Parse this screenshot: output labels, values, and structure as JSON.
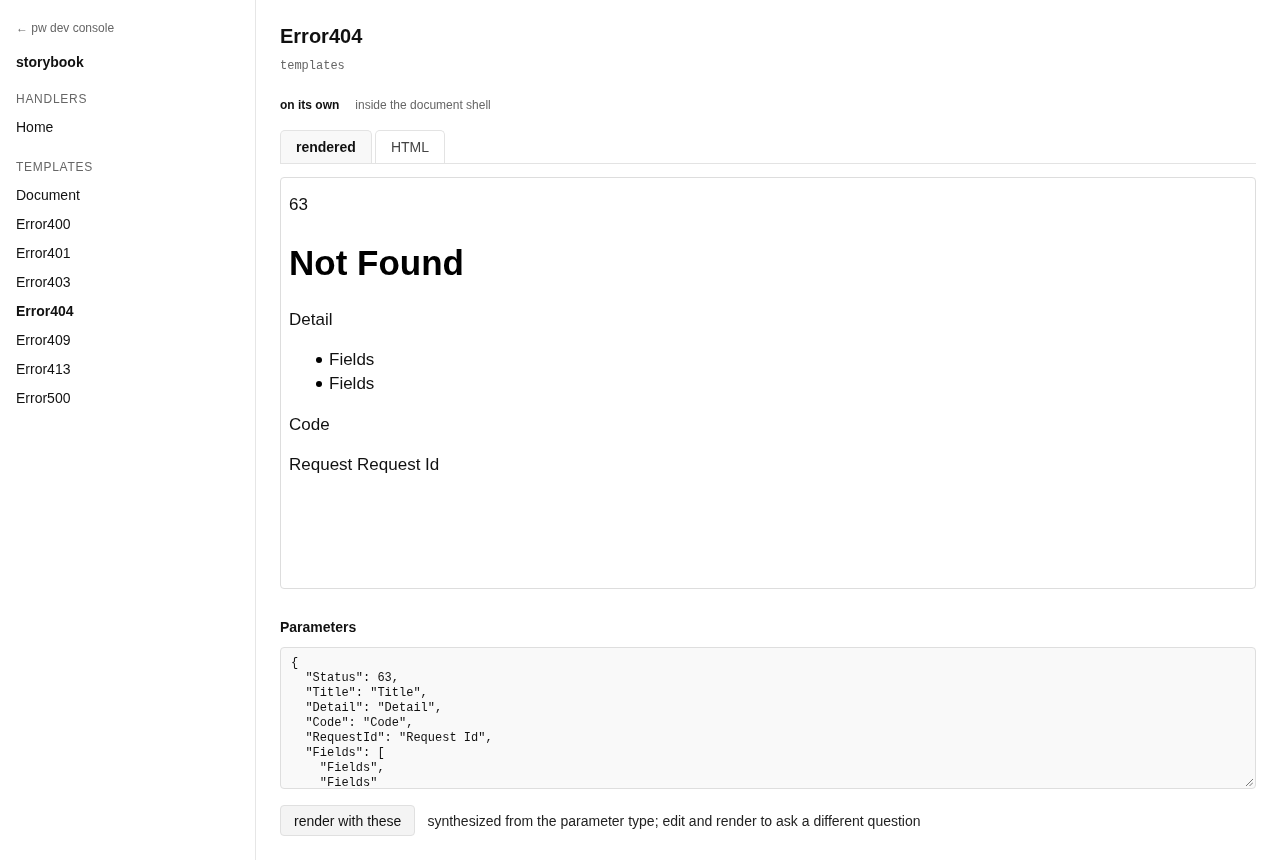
{
  "sidebar": {
    "back_link": "← pw dev console",
    "title": "storybook",
    "sections": [
      {
        "heading": "HANDLERS",
        "items": [
          {
            "label": "Home",
            "selected": false
          }
        ]
      },
      {
        "heading": "TEMPLATES",
        "items": [
          {
            "label": "Document",
            "selected": false
          },
          {
            "label": "Error400",
            "selected": false
          },
          {
            "label": "Error401",
            "selected": false
          },
          {
            "label": "Error403",
            "selected": false
          },
          {
            "label": "Error404",
            "selected": true
          },
          {
            "label": "Error409",
            "selected": false
          },
          {
            "label": "Error413",
            "selected": false
          },
          {
            "label": "Error500",
            "selected": false
          }
        ]
      }
    ]
  },
  "header": {
    "title": "Error404",
    "subtitle": "templates"
  },
  "modes": [
    {
      "label": "on its own",
      "selected": true
    },
    {
      "label": "inside the document shell",
      "selected": false
    }
  ],
  "tabs": [
    {
      "label": "rendered",
      "selected": true
    },
    {
      "label": "HTML",
      "selected": false
    }
  ],
  "preview": {
    "status": "63",
    "title": "Not Found",
    "detail": "Detail",
    "fields": [
      "Fields",
      "Fields"
    ],
    "code": "Code",
    "request": "Request Request Id"
  },
  "parameters": {
    "heading": "Parameters",
    "value": "{\n  \"Status\": 63,\n  \"Title\": \"Title\",\n  \"Detail\": \"Detail\",\n  \"Code\": \"Code\",\n  \"RequestId\": \"Request Id\",\n  \"Fields\": [\n    \"Fields\",\n    \"Fields\"",
    "button": "render with these",
    "hint": "synthesized from the parameter type; edit and render to ask a different question"
  }
}
